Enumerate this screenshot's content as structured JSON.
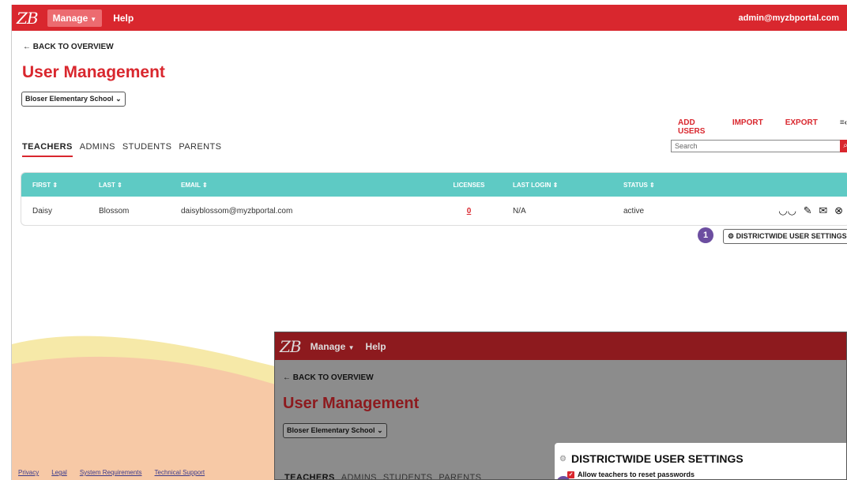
{
  "topbar": {
    "logo": "ZB",
    "manage_label": "Manage",
    "help_label": "Help",
    "user_email": "admin@myzbportal.com"
  },
  "page": {
    "back_label": "← BACK TO OVERVIEW",
    "title": "User Management",
    "school_select": "Bloser Elementary School"
  },
  "actions": {
    "add_users": "ADD USERS",
    "import": "IMPORT",
    "export": "EXPORT",
    "more": "≡‹"
  },
  "tabs": [
    "TEACHERS",
    "ADMINS",
    "STUDENTS",
    "PARENTS"
  ],
  "active_tab": "TEACHERS",
  "search": {
    "placeholder": "Search"
  },
  "table": {
    "headers": {
      "first": "FIRST ⇕",
      "last": "LAST ⇕",
      "email": "EMAIL ⇕",
      "licenses": "LICENSES",
      "last_login": "LAST LOGIN ⇕",
      "status": "STATUS ⇕"
    },
    "rows": [
      {
        "first": "Daisy",
        "last": "Blossom",
        "email": "daisyblossom@myzbportal.com",
        "licenses": "0",
        "last_login": "N/A",
        "status": "active"
      }
    ]
  },
  "callout": {
    "badge": "1",
    "button_label": "DISTRICTWIDE USER SETTINGS"
  },
  "footer": {
    "links": [
      "Privacy",
      "Legal",
      "System Requirements",
      "Technical Support"
    ]
  },
  "overlay": {
    "logo": "ZB",
    "manage_label": "Manage",
    "help_label": "Help",
    "back_label": "← BACK TO OVERVIEW",
    "title": "User Management",
    "school_select": "Bloser Elementary School",
    "tabs": [
      "TEACHERS",
      "ADMINS",
      "STUDENTS",
      "PARENTS"
    ],
    "panel_title": "DISTRICTWIDE USER SETTINGS",
    "option_label": "Allow teachers to reset passwords"
  },
  "colors": {
    "brand_red": "#d9272e",
    "header_teal": "#5ecac4",
    "badge_purple": "#6c4ea0"
  }
}
